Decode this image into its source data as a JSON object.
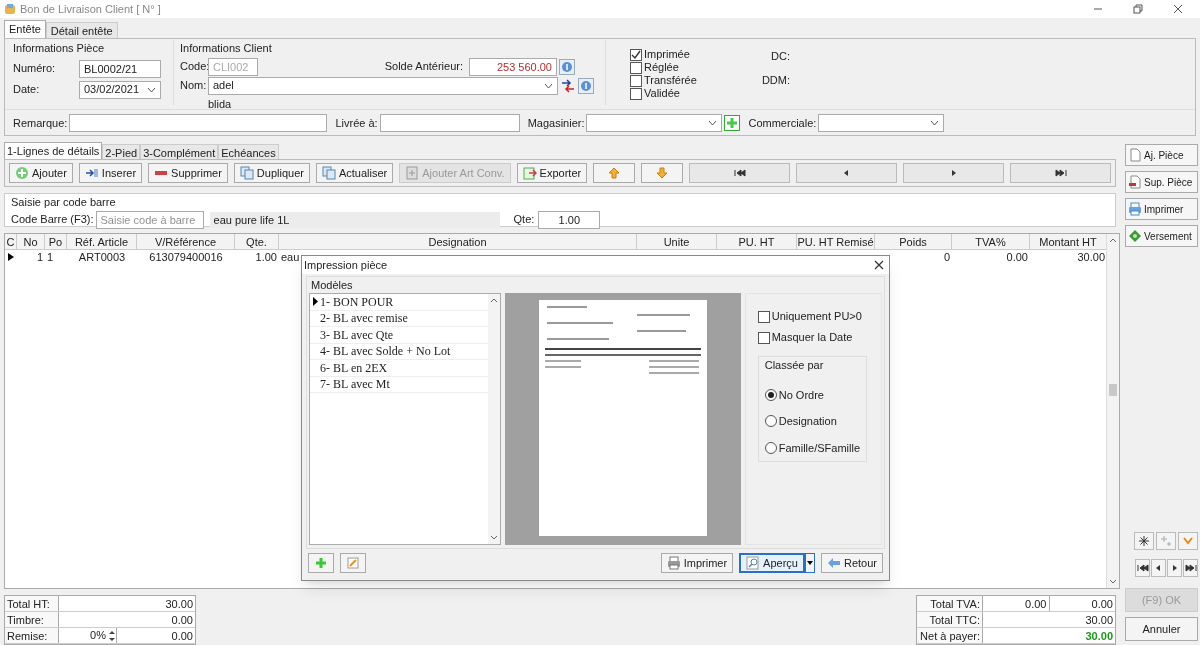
{
  "window": {
    "title": "Bon de Livraison Client [ N° ]"
  },
  "header_tabs": [
    {
      "label": "Entête",
      "selected": true
    },
    {
      "label": "Détail entête",
      "selected": false
    }
  ],
  "piece_info": {
    "title": "Informations Pièce",
    "numero_label": "Numéro:",
    "numero": "BL0002/21",
    "date_label": "Date:",
    "date": "03/02/2021"
  },
  "client_info": {
    "title": "Informations Client",
    "code_label": "Code:",
    "code": "CLI002",
    "nom_label": "Nom:",
    "nom": "adel",
    "address": "blida",
    "solde_label": "Solde Antérieur:",
    "solde": "253 560.00"
  },
  "status_checks": [
    {
      "label": "Imprimée",
      "checked": true
    },
    {
      "label": "Réglée",
      "checked": false
    },
    {
      "label": "Transférée",
      "checked": false
    },
    {
      "label": "Validée",
      "checked": false
    }
  ],
  "dates": [
    {
      "label": "DC:"
    },
    {
      "label": "DDM:"
    }
  ],
  "fields": {
    "remarque_label": "Remarque:",
    "livree_label": "Livrée à:",
    "magasinier_label": "Magasinier:",
    "commerciale_label": "Commerciale:"
  },
  "detail_tabs": [
    {
      "label": "1-Lignes de détails",
      "selected": true
    },
    {
      "label": "2-Pied",
      "selected": false
    },
    {
      "label": "3-Complément",
      "selected": false
    },
    {
      "label": "Echéances",
      "selected": false
    }
  ],
  "toolbar": [
    {
      "kind": "add",
      "label": "Ajouter",
      "disabled": false
    },
    {
      "kind": "insert",
      "label": "Inserer",
      "disabled": false
    },
    {
      "kind": "delete",
      "label": "Supprimer",
      "disabled": false
    },
    {
      "kind": "copy",
      "label": "Dupliquer",
      "disabled": false
    },
    {
      "kind": "copy",
      "label": "Actualiser",
      "disabled": false
    },
    {
      "kind": "conv",
      "label": "Ajouter Art Conv.",
      "disabled": true
    },
    {
      "kind": "export",
      "label": "Exporter",
      "disabled": false
    }
  ],
  "barcode": {
    "title": "Saisie par code barre",
    "label": "Code Barre (F3):",
    "placeholder": "Saisie code à barre",
    "article": "eau  pure life 1L",
    "qty_label": "Qte:",
    "qty": "1.00"
  },
  "table": {
    "columns": [
      "C",
      "No",
      "Po",
      "Réf. Article",
      "V/Référence",
      "Qte.",
      "Designation",
      "Unite",
      "PU. HT",
      "PU. HT Remisé",
      "Poids",
      "TVA%",
      "Montant HT"
    ],
    "rows": [
      {
        "selected": true,
        "cells": [
          "",
          "1",
          "1",
          "ART0003",
          "613079400016",
          "1.00",
          "eau",
          "",
          "",
          "",
          "0",
          "0.00",
          "30.00"
        ]
      }
    ]
  },
  "side_buttons": [
    {
      "kind": "new",
      "label": "Aj. Pièce"
    },
    {
      "kind": "delete",
      "label": "Sup. Pièce"
    },
    {
      "kind": "print",
      "label": "Imprimer"
    },
    {
      "kind": "money",
      "label": "Versement"
    }
  ],
  "totals_left": [
    {
      "label": "Total HT:",
      "value": "30.00"
    },
    {
      "label": "Timbre:",
      "value": "0.00"
    },
    {
      "label": "Remise:",
      "percent": "0%",
      "value": "0.00"
    }
  ],
  "totals_right": [
    {
      "label": "Total TVA:",
      "values": [
        "0.00",
        "0.00"
      ]
    },
    {
      "label": "Total TTC:",
      "values": [
        "30.00"
      ]
    },
    {
      "label": "Net à payer:",
      "values": [
        "30.00"
      ],
      "highlight": true
    }
  ],
  "ok_button": {
    "label": "(F9) OK",
    "disabled": true
  },
  "cancel_button": {
    "label": "Annuler"
  },
  "dialog": {
    "title": "Impression pièce",
    "group": "Modèles",
    "models": [
      {
        "label": "1- BON POUR",
        "selected": true
      },
      {
        "label": "2- BL avec remise",
        "selected": false
      },
      {
        "label": "3- BL avec Qte",
        "selected": false
      },
      {
        "label": "4- BL avec Solde + No Lot",
        "selected": false
      },
      {
        "label": "6- BL en 2EX",
        "selected": false
      },
      {
        "label": "7- BL avec Mt",
        "selected": false
      }
    ],
    "options": [
      {
        "label": "Uniquement PU>0",
        "checked": false
      },
      {
        "label": "Masquer la Date",
        "checked": false
      }
    ],
    "sort_title": "Classée par",
    "sort": [
      {
        "label": "No Ordre",
        "selected": true
      },
      {
        "label": "Designation",
        "selected": false
      },
      {
        "label": "Famille/SFamille",
        "selected": false
      }
    ],
    "buttons": [
      {
        "kind": "print",
        "label": "Imprimer",
        "default": false
      },
      {
        "kind": "preview",
        "label": "Aperçu",
        "default": true
      },
      {
        "kind": "back",
        "label": "Retour",
        "default": false
      }
    ]
  }
}
